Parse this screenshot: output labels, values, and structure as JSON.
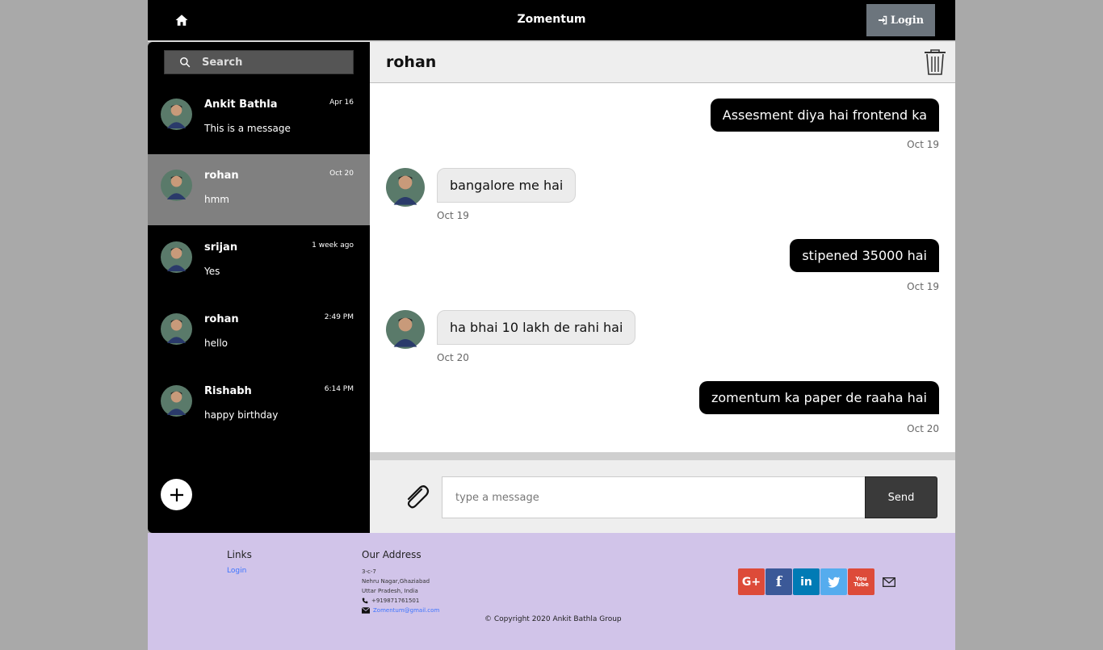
{
  "navbar": {
    "brand": "Zomentum",
    "login_label": "Login",
    "home_icon": "home-icon"
  },
  "sidebar": {
    "search_placeholder": "Search",
    "conversations": [
      {
        "name": "Ankit Bathla",
        "time": "Apr 16",
        "preview": "This is a message",
        "active": false
      },
      {
        "name": "rohan",
        "time": "Oct 20",
        "preview": "hmm",
        "active": true
      },
      {
        "name": "srijan",
        "time": "1 week ago",
        "preview": "Yes",
        "active": false
      },
      {
        "name": "rohan",
        "time": "2:49 PM",
        "preview": "hello",
        "active": false
      },
      {
        "name": "Rishabh",
        "time": "6:14 PM",
        "preview": "happy birthday",
        "active": false
      }
    ]
  },
  "chat": {
    "title": "rohan",
    "messages": [
      {
        "direction": "out",
        "text": "Assesment diya hai frontend ka",
        "date": "Oct 19"
      },
      {
        "direction": "in",
        "text": "bangalore me hai",
        "date": "Oct 19"
      },
      {
        "direction": "out",
        "text": "stipened 35000 hai",
        "date": "Oct 19"
      },
      {
        "direction": "in",
        "text": "ha bhai 10 lakh de rahi hai",
        "date": "Oct 20"
      },
      {
        "direction": "out",
        "text": "zomentum ka paper de raaha hai",
        "date": "Oct 20"
      }
    ],
    "input_placeholder": "type a message",
    "send_label": "Send"
  },
  "footer": {
    "links_heading": "Links",
    "links": [
      "Login"
    ],
    "address_heading": "Our Address",
    "address_lines": [
      "3-c-7",
      "Nehru Nagar,Ghaziabad",
      "Uttar Pradesh, India"
    ],
    "phone": "+919871761501",
    "email": "Zomentum@gmail.com",
    "copyright": "© Copyright 2020 Ankit Bathla Group",
    "social": [
      {
        "label": "G+",
        "color": "#dd4b39",
        "icon": "google-plus-icon"
      },
      {
        "label": "f",
        "color": "#3b5998",
        "icon": "facebook-icon"
      },
      {
        "label": "in",
        "color": "#007bb5",
        "icon": "linkedin-icon"
      },
      {
        "label": "",
        "color": "#55acee",
        "icon": "twitter-icon"
      },
      {
        "label": "You\nTube",
        "color": "#dd4b39",
        "icon": "youtube-icon"
      }
    ]
  },
  "colors": {
    "page_bg": "#a9a9a9",
    "nav_bg": "#000000",
    "active_conversation": "#808080",
    "footer_bg": "#d1c4e9",
    "outgoing_bubble": "#000000",
    "incoming_bubble": "#ececec"
  }
}
